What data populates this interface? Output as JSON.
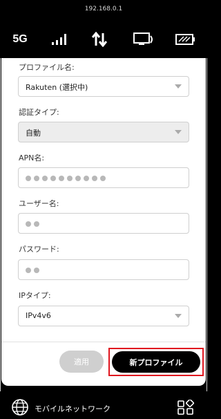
{
  "browser": {
    "url": "192.168.0.1"
  },
  "status_bar": {
    "network_label": "5G"
  },
  "form": {
    "profile_name_label": "プロファイル名:",
    "profile_name_value": "Rakuten (選択中)",
    "auth_type_label": "認証タイプ:",
    "auth_type_value": "自動",
    "apn_label": "APN名:",
    "apn_value_mask_length": 10,
    "username_label": "ユーザー名:",
    "username_mask_length": 2,
    "password_label": "パスワード:",
    "password_mask_length": 2,
    "ip_type_label": "IPタイプ:",
    "ip_type_value": "IPv4v6"
  },
  "actions": {
    "apply_label": "適用",
    "new_profile_label": "新プロファイル"
  },
  "bottom_nav": {
    "mobile_network_label": "モバイルネットワーク"
  },
  "colors": {
    "highlight": "#e0141e",
    "primary_button": "#000000",
    "disabled_button": "#cfcfcf"
  }
}
